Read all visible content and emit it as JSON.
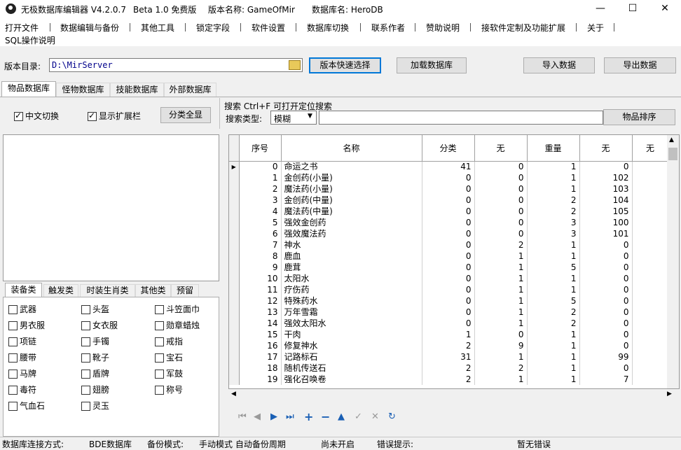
{
  "window": {
    "title": "无极数据库编辑器 V4.2.0.7",
    "beta": "Beta 1.0 免费版",
    "version_label": "版本名称: GameOfMir",
    "db_label": "数据库名: HeroDB"
  },
  "menu": [
    "打开文件",
    "数据编辑与备份",
    "其他工具",
    "锁定字段",
    "软件设置",
    "数据库切换",
    "联系作者",
    "赞助说明",
    "接软件定制及功能扩展",
    "关于",
    "SQL操作说明"
  ],
  "toolbar": {
    "dir_label": "版本目录:",
    "dir_value": "D:\\MirServer",
    "quick_select": "版本快速选择",
    "load_db": "加载数据库",
    "import": "导入数据",
    "export": "导出数据"
  },
  "tabs": [
    "物品数据库",
    "怪物数据库",
    "技能数据库",
    "外部数据库"
  ],
  "options": {
    "chinese_switch": "中文切换",
    "show_ext": "显示扩展栏",
    "show_all": "分类全显"
  },
  "search": {
    "title": "搜索  Ctrl+F 可打开定位搜索",
    "type_label": "搜索类型:",
    "type_value": "模糊",
    "sort_button": "物品排序"
  },
  "category_tabs": [
    "装备类",
    "触发类",
    "时装生肖类",
    "其他类",
    "预留"
  ],
  "categories": [
    "武器",
    "头盔",
    "斗笠面巾",
    "男衣服",
    "女衣服",
    "勋章蜡烛",
    "项链",
    "手镯",
    "戒指",
    "腰带",
    "靴子",
    "宝石",
    "马牌",
    "盾牌",
    "军鼓",
    "毒符",
    "翅膀",
    "称号",
    "气血石",
    "灵玉"
  ],
  "grid": {
    "columns": [
      "序号",
      "名称",
      "分类",
      "无",
      "重量",
      "无",
      "无"
    ],
    "rows": [
      [
        "0",
        "命运之书",
        "41",
        "0",
        "1",
        "0"
      ],
      [
        "1",
        "金创药(小量)",
        "0",
        "0",
        "1",
        "102"
      ],
      [
        "2",
        "魔法药(小量)",
        "0",
        "0",
        "1",
        "103"
      ],
      [
        "3",
        "金创药(中量)",
        "0",
        "0",
        "2",
        "104"
      ],
      [
        "4",
        "魔法药(中量)",
        "0",
        "0",
        "2",
        "105"
      ],
      [
        "5",
        "强效金创药",
        "0",
        "0",
        "3",
        "100"
      ],
      [
        "6",
        "强效魔法药",
        "0",
        "0",
        "3",
        "101"
      ],
      [
        "7",
        "神水",
        "0",
        "2",
        "1",
        "0"
      ],
      [
        "8",
        "鹿血",
        "0",
        "1",
        "1",
        "0"
      ],
      [
        "9",
        "鹿茸",
        "0",
        "1",
        "5",
        "0"
      ],
      [
        "10",
        "太阳水",
        "0",
        "1",
        "1",
        "0"
      ],
      [
        "11",
        "疗伤药",
        "0",
        "1",
        "1",
        "0"
      ],
      [
        "12",
        "特殊药水",
        "0",
        "1",
        "5",
        "0"
      ],
      [
        "13",
        "万年雪霜",
        "0",
        "1",
        "2",
        "0"
      ],
      [
        "14",
        "强效太阳水",
        "0",
        "1",
        "2",
        "0"
      ],
      [
        "15",
        "干肉",
        "1",
        "0",
        "1",
        "0"
      ],
      [
        "16",
        "修复神水",
        "2",
        "9",
        "1",
        "0"
      ],
      [
        "17",
        "记路标石",
        "31",
        "1",
        "1",
        "99"
      ],
      [
        "18",
        "随机传送石",
        "2",
        "2",
        "1",
        "0"
      ],
      [
        "19",
        "强化召唤卷",
        "2",
        "1",
        "1",
        "7"
      ]
    ]
  },
  "status": {
    "conn_label": "数据库连接方式:",
    "conn_value": "BDE数据库",
    "backup_label": "备份模式:",
    "backup_value": "手动模式  自动备份周期",
    "pending": "尚未开启",
    "error_hint": "错误提示:",
    "error_value": "暂无错误"
  },
  "colors": {
    "title_bg": "#ffffff",
    "window_bg": "#f0f0f0",
    "focus": "#0078d7",
    "nav_icon": "#1a5fb4"
  }
}
